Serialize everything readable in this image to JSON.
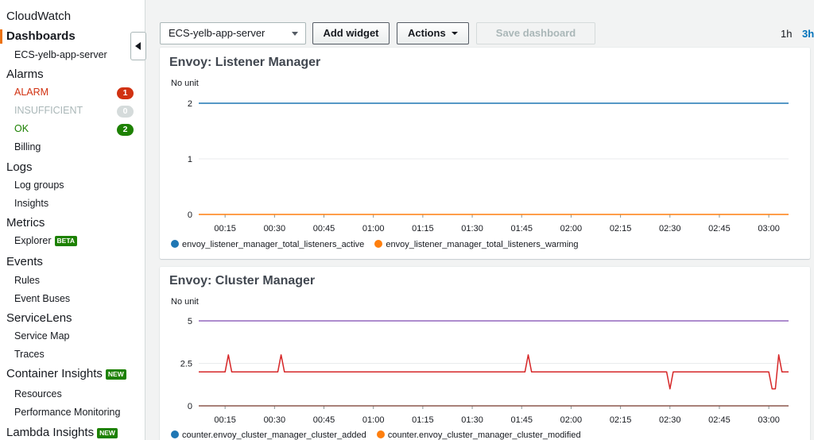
{
  "sidebar": {
    "cloudwatch": "CloudWatch",
    "dashboards": "Dashboards",
    "dashboard_item": "ECS-yelb-app-server",
    "alarms": "Alarms",
    "alarm_items": [
      {
        "label": "ALARM",
        "count": "1"
      },
      {
        "label": "INSUFFICIENT",
        "count": "0"
      },
      {
        "label": "OK",
        "count": "2"
      }
    ],
    "billing": "Billing",
    "logs": "Logs",
    "log_groups": "Log groups",
    "insights": "Insights",
    "metrics": "Metrics",
    "explorer": "Explorer",
    "beta_tag": "BETA",
    "events": "Events",
    "rules": "Rules",
    "event_buses": "Event Buses",
    "servicelens": "ServiceLens",
    "service_map": "Service Map",
    "traces": "Traces",
    "container_insights": "Container Insights",
    "new_tag": "NEW",
    "resources": "Resources",
    "performance_monitoring": "Performance Monitoring",
    "lambda_insights": "Lambda Insights"
  },
  "toolbar": {
    "dashboard_select": "ECS-yelb-app-server",
    "add_widget": "Add widget",
    "actions": "Actions",
    "save_dashboard": "Save dashboard",
    "range_1h": "1h",
    "range_3h": "3h"
  },
  "colors": {
    "accent": "#ec7211",
    "link": "#0073bb",
    "alarm": "#d13212",
    "ok": "#1d8102",
    "series_blue": "#1f77b4",
    "series_orange": "#ff7f0e",
    "series_purple": "#9467bd",
    "series_red": "#d62728"
  },
  "icons": {
    "collapse": "caret-left-icon",
    "dropdown": "caret-down-icon"
  },
  "widgets": [
    {
      "title": "Envoy: Listener Manager",
      "unit": "No unit",
      "legend": [
        "envoy_listener_manager_total_listeners_active",
        "envoy_listener_manager_total_listeners_warming"
      ]
    },
    {
      "title": "Envoy: Cluster Manager",
      "unit": "No unit",
      "legend": [
        "counter.envoy_cluster_manager_cluster_added",
        "counter.envoy_cluster_manager_cluster_modified"
      ]
    }
  ],
  "chart_data": [
    {
      "type": "line",
      "title": "Envoy: Listener Manager",
      "ylabel": "No unit",
      "ylim": [
        0,
        2
      ],
      "yticks": [
        "0",
        "1",
        "2"
      ],
      "xticks": [
        "00:15",
        "00:30",
        "00:45",
        "01:00",
        "01:15",
        "01:30",
        "01:45",
        "02:00",
        "02:15",
        "02:30",
        "02:45",
        "03:00"
      ],
      "x": [
        "00:07",
        "03:06"
      ],
      "grid": true,
      "legend_position": "bottom",
      "series": [
        {
          "name": "envoy_listener_manager_total_listeners_active",
          "color": "#1f77b4",
          "values": [
            2,
            2
          ]
        },
        {
          "name": "envoy_listener_manager_total_listeners_warming",
          "color": "#ff7f0e",
          "values": [
            0,
            0
          ]
        }
      ]
    },
    {
      "type": "line",
      "title": "Envoy: Cluster Manager",
      "ylabel": "No unit",
      "ylim": [
        0,
        5
      ],
      "yticks": [
        "0",
        "2.5",
        "5"
      ],
      "xticks": [
        "00:15",
        "00:30",
        "00:45",
        "01:00",
        "01:15",
        "01:30",
        "01:45",
        "02:00",
        "02:15",
        "02:30",
        "02:45",
        "03:00"
      ],
      "grid": true,
      "legend_position": "bottom",
      "series": [
        {
          "name": "",
          "color": "#9467bd",
          "x": [
            "00:07",
            "03:06"
          ],
          "values": [
            5,
            5
          ]
        },
        {
          "name": "",
          "color": "#d62728",
          "x": [
            "00:07",
            "00:15",
            "00:16",
            "00:17",
            "00:31",
            "00:32",
            "00:33",
            "01:46",
            "01:47",
            "01:48",
            "02:29",
            "02:30",
            "02:31",
            "03:00",
            "03:01",
            "03:02",
            "03:03",
            "03:04",
            "03:06"
          ],
          "values": [
            2,
            2,
            3,
            2,
            2,
            3,
            2,
            2,
            3,
            2,
            2,
            1,
            2,
            2,
            1,
            1,
            3,
            2,
            2
          ]
        },
        {
          "name": "",
          "color": "#8c564b",
          "x": [
            "00:07",
            "03:06"
          ],
          "values": [
            0,
            0
          ]
        }
      ]
    }
  ]
}
